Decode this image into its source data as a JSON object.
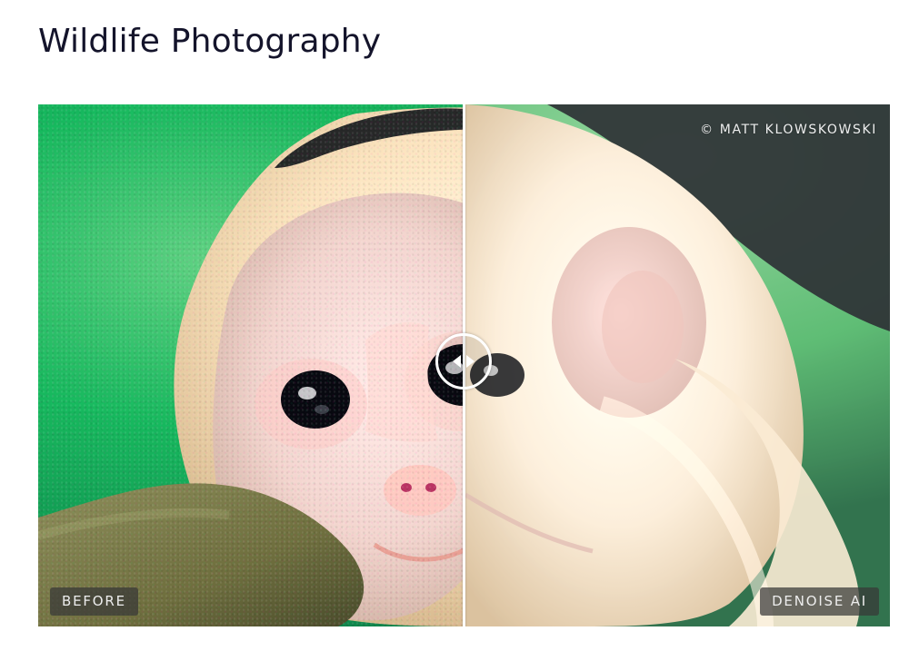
{
  "page": {
    "title": "Wildlife Photography"
  },
  "comparison": {
    "credit": "© MATT KLOWSKOWSKI",
    "before_label": "BEFORE",
    "after_label": "DENOISE AI",
    "handle_icon": "double-arrow-icon"
  },
  "colors": {
    "title_text": "#14142b",
    "badge_bg": "#373737",
    "divider": "#ffffff"
  }
}
